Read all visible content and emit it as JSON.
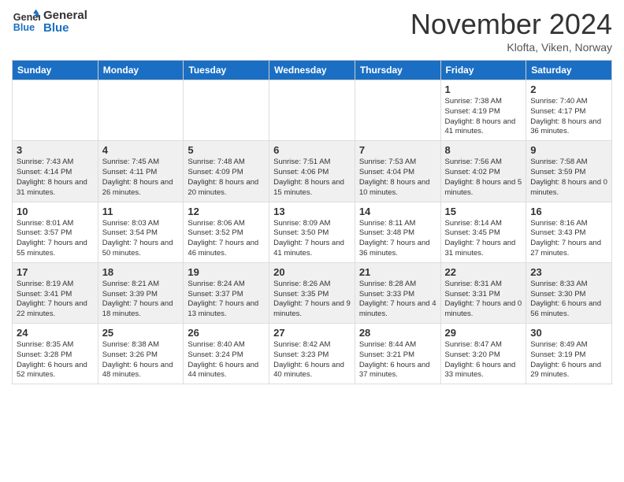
{
  "header": {
    "logo_line1": "General",
    "logo_line2": "Blue",
    "month_title": "November 2024",
    "location": "Klofta, Viken, Norway"
  },
  "days_of_week": [
    "Sunday",
    "Monday",
    "Tuesday",
    "Wednesday",
    "Thursday",
    "Friday",
    "Saturday"
  ],
  "weeks": [
    [
      {
        "day": "",
        "info": ""
      },
      {
        "day": "",
        "info": ""
      },
      {
        "day": "",
        "info": ""
      },
      {
        "day": "",
        "info": ""
      },
      {
        "day": "",
        "info": ""
      },
      {
        "day": "1",
        "info": "Sunrise: 7:38 AM\nSunset: 4:19 PM\nDaylight: 8 hours and 41 minutes."
      },
      {
        "day": "2",
        "info": "Sunrise: 7:40 AM\nSunset: 4:17 PM\nDaylight: 8 hours and 36 minutes."
      }
    ],
    [
      {
        "day": "3",
        "info": "Sunrise: 7:43 AM\nSunset: 4:14 PM\nDaylight: 8 hours and 31 minutes."
      },
      {
        "day": "4",
        "info": "Sunrise: 7:45 AM\nSunset: 4:11 PM\nDaylight: 8 hours and 26 minutes."
      },
      {
        "day": "5",
        "info": "Sunrise: 7:48 AM\nSunset: 4:09 PM\nDaylight: 8 hours and 20 minutes."
      },
      {
        "day": "6",
        "info": "Sunrise: 7:51 AM\nSunset: 4:06 PM\nDaylight: 8 hours and 15 minutes."
      },
      {
        "day": "7",
        "info": "Sunrise: 7:53 AM\nSunset: 4:04 PM\nDaylight: 8 hours and 10 minutes."
      },
      {
        "day": "8",
        "info": "Sunrise: 7:56 AM\nSunset: 4:02 PM\nDaylight: 8 hours and 5 minutes."
      },
      {
        "day": "9",
        "info": "Sunrise: 7:58 AM\nSunset: 3:59 PM\nDaylight: 8 hours and 0 minutes."
      }
    ],
    [
      {
        "day": "10",
        "info": "Sunrise: 8:01 AM\nSunset: 3:57 PM\nDaylight: 7 hours and 55 minutes."
      },
      {
        "day": "11",
        "info": "Sunrise: 8:03 AM\nSunset: 3:54 PM\nDaylight: 7 hours and 50 minutes."
      },
      {
        "day": "12",
        "info": "Sunrise: 8:06 AM\nSunset: 3:52 PM\nDaylight: 7 hours and 46 minutes."
      },
      {
        "day": "13",
        "info": "Sunrise: 8:09 AM\nSunset: 3:50 PM\nDaylight: 7 hours and 41 minutes."
      },
      {
        "day": "14",
        "info": "Sunrise: 8:11 AM\nSunset: 3:48 PM\nDaylight: 7 hours and 36 minutes."
      },
      {
        "day": "15",
        "info": "Sunrise: 8:14 AM\nSunset: 3:45 PM\nDaylight: 7 hours and 31 minutes."
      },
      {
        "day": "16",
        "info": "Sunrise: 8:16 AM\nSunset: 3:43 PM\nDaylight: 7 hours and 27 minutes."
      }
    ],
    [
      {
        "day": "17",
        "info": "Sunrise: 8:19 AM\nSunset: 3:41 PM\nDaylight: 7 hours and 22 minutes."
      },
      {
        "day": "18",
        "info": "Sunrise: 8:21 AM\nSunset: 3:39 PM\nDaylight: 7 hours and 18 minutes."
      },
      {
        "day": "19",
        "info": "Sunrise: 8:24 AM\nSunset: 3:37 PM\nDaylight: 7 hours and 13 minutes."
      },
      {
        "day": "20",
        "info": "Sunrise: 8:26 AM\nSunset: 3:35 PM\nDaylight: 7 hours and 9 minutes."
      },
      {
        "day": "21",
        "info": "Sunrise: 8:28 AM\nSunset: 3:33 PM\nDaylight: 7 hours and 4 minutes."
      },
      {
        "day": "22",
        "info": "Sunrise: 8:31 AM\nSunset: 3:31 PM\nDaylight: 7 hours and 0 minutes."
      },
      {
        "day": "23",
        "info": "Sunrise: 8:33 AM\nSunset: 3:30 PM\nDaylight: 6 hours and 56 minutes."
      }
    ],
    [
      {
        "day": "24",
        "info": "Sunrise: 8:35 AM\nSunset: 3:28 PM\nDaylight: 6 hours and 52 minutes."
      },
      {
        "day": "25",
        "info": "Sunrise: 8:38 AM\nSunset: 3:26 PM\nDaylight: 6 hours and 48 minutes."
      },
      {
        "day": "26",
        "info": "Sunrise: 8:40 AM\nSunset: 3:24 PM\nDaylight: 6 hours and 44 minutes."
      },
      {
        "day": "27",
        "info": "Sunrise: 8:42 AM\nSunset: 3:23 PM\nDaylight: 6 hours and 40 minutes."
      },
      {
        "day": "28",
        "info": "Sunrise: 8:44 AM\nSunset: 3:21 PM\nDaylight: 6 hours and 37 minutes."
      },
      {
        "day": "29",
        "info": "Sunrise: 8:47 AM\nSunset: 3:20 PM\nDaylight: 6 hours and 33 minutes."
      },
      {
        "day": "30",
        "info": "Sunrise: 8:49 AM\nSunset: 3:19 PM\nDaylight: 6 hours and 29 minutes."
      }
    ]
  ]
}
